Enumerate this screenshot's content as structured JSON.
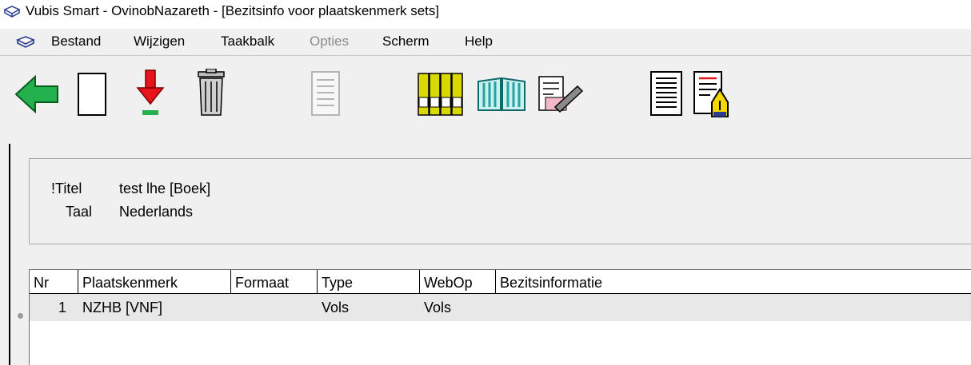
{
  "window": {
    "title": "Vubis Smart - OvinobNazareth - [Bezitsinfo voor plaatskenmerk sets]"
  },
  "menu": {
    "items": [
      {
        "label": "Bestand",
        "enabled": true
      },
      {
        "label": "Wijzigen",
        "enabled": true
      },
      {
        "label": "Taakbalk",
        "enabled": true
      },
      {
        "label": "Opties",
        "enabled": false
      },
      {
        "label": "Scherm",
        "enabled": true
      },
      {
        "label": "Help",
        "enabled": true
      }
    ]
  },
  "toolbar": {
    "buttons": [
      {
        "icon": "back-arrow-icon",
        "enabled": true
      },
      {
        "icon": "new-document-icon",
        "enabled": true
      },
      {
        "icon": "save-download-icon",
        "enabled": true
      },
      {
        "icon": "trash-icon",
        "enabled": true
      },
      {
        "icon": "document-lines-icon",
        "enabled": false
      },
      {
        "icon": "books-abcd-icon",
        "enabled": true
      },
      {
        "icon": "open-book-icon",
        "enabled": true
      },
      {
        "icon": "edit-pen-icon",
        "enabled": true
      },
      {
        "icon": "list-document-icon",
        "enabled": true
      },
      {
        "icon": "document-pen-icon",
        "enabled": true
      }
    ]
  },
  "info": {
    "fields": [
      {
        "label": "!Titel",
        "value": "test lhe [Boek]"
      },
      {
        "label": "Taal",
        "value": "Nederlands"
      }
    ]
  },
  "grid": {
    "columns": [
      "Nr",
      "Plaatskenmerk",
      "Formaat",
      "Type",
      "WebOp",
      "Bezitsinformatie"
    ],
    "rows": [
      {
        "nr": "1",
        "plaatskenmerk": "NZHB [VNF]",
        "formaat": "",
        "type": "Vols",
        "webop": "Vols",
        "bezitsinformatie": ""
      }
    ]
  },
  "colors": {
    "accent_green": "#22b14c",
    "accent_red": "#e8141b",
    "book_yellow": "#d9d900",
    "book_teal": "#21a5a5"
  }
}
